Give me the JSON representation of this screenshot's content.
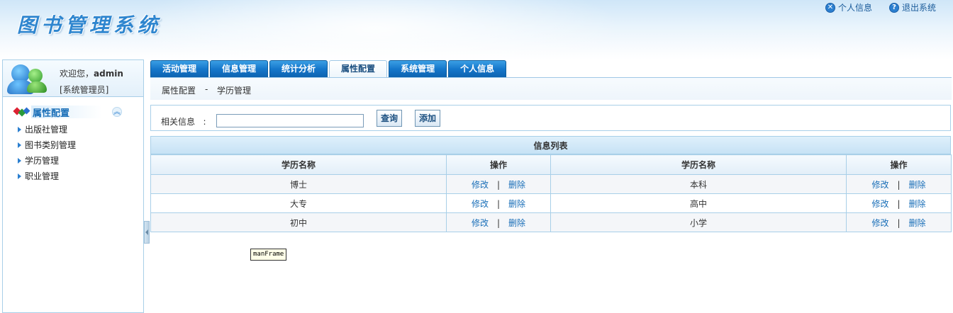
{
  "header": {
    "app_title": "图书管理系统",
    "links": [
      {
        "label": "个人信息",
        "icon": "x-circle-icon"
      },
      {
        "label": "退出系统",
        "icon": "help-circle-icon"
      }
    ]
  },
  "user": {
    "welcome_prefix": "欢迎您，",
    "name": "admin",
    "role": "[系统管理员]"
  },
  "sidebar": {
    "section_title": "属性配置",
    "items": [
      {
        "label": "出版社管理"
      },
      {
        "label": "图书类别管理"
      },
      {
        "label": "学历管理"
      },
      {
        "label": "职业管理"
      }
    ]
  },
  "tabs": [
    {
      "label": "活动管理",
      "active": false
    },
    {
      "label": "信息管理",
      "active": false
    },
    {
      "label": "统计分析",
      "active": false
    },
    {
      "label": "属性配置",
      "active": true
    },
    {
      "label": "系统管理",
      "active": false
    },
    {
      "label": "个人信息",
      "active": false
    }
  ],
  "breadcrumb": {
    "parent": "属性配置",
    "separator": "-",
    "current": "学历管理"
  },
  "search": {
    "label": "相关信息",
    "colon": ":",
    "value": "",
    "query_button": "查询",
    "add_button": "添加"
  },
  "grid": {
    "title": "信息列表",
    "headers": [
      "学历名称",
      "操作",
      "学历名称",
      "操作"
    ],
    "edit_label": "修改",
    "separator": "|",
    "delete_label": "删除",
    "rows": [
      [
        "博士",
        "本科"
      ],
      [
        "大专",
        "高中"
      ],
      [
        "初中",
        "小学"
      ]
    ]
  },
  "frame_label": "manFrame",
  "colors": {
    "tab_blue": "#1577cb",
    "link_blue": "#1a6fb8",
    "border_light_blue": "#a8cfe8"
  }
}
